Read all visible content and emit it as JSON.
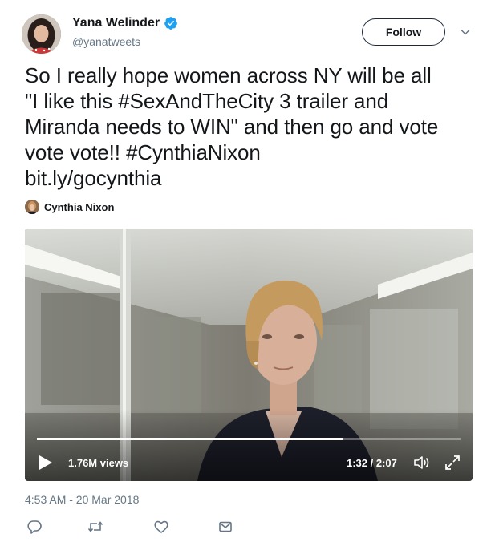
{
  "user": {
    "name": "Yana Welinder",
    "handle": "@yanatweets",
    "verified": true,
    "verified_icon": "verified-badge-icon",
    "verified_color": "#1da1f2"
  },
  "follow_label": "Follow",
  "tweet_lines": [
    "So I really hope women across NY will be all",
    "\"I like this #SexAndTheCity 3 trailer and",
    "Miranda needs to WIN\" and then go and vote",
    "vote vote!! #CynthiaNixon",
    "bit.ly/gocynthia"
  ],
  "attribution": {
    "name": "Cynthia Nixon"
  },
  "video": {
    "views": "1.76M views",
    "time": "1:32 / 2:07",
    "progress": 0.724,
    "play_icon": "play-icon",
    "volume_icon": "volume-icon",
    "fullscreen_icon": "fullscreen-icon"
  },
  "timestamp": "4:53 AM - 20 Mar 2018",
  "actions": [
    "reply-icon",
    "retweet-icon",
    "like-icon",
    "message-icon"
  ],
  "colors": {
    "text": "#14171a",
    "secondary": "#657786",
    "link": "#1da1f2"
  }
}
